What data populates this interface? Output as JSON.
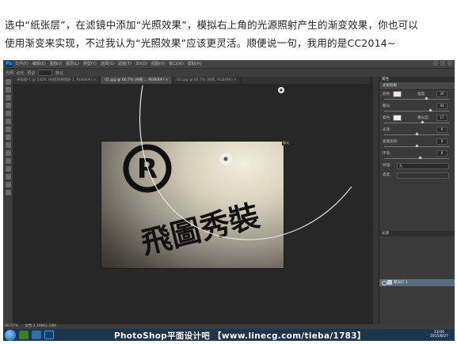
{
  "article": {
    "line1": "选中“纸张层”，在滤镜中添加“光照效果”，模拟右上角的光源照射产生的渐变效果，你也可以",
    "line2": "使用渐变来实现，不过我认为“光照效果”应该更灵活。顺便说一句，我用的是CC2014~"
  },
  "photoshop": {
    "app_logo": "Ps",
    "menu": [
      "文件(F)",
      "编辑(E)",
      "图像(I)",
      "图层(L)",
      "类型(Y)",
      "选择(S)",
      "滤镜(T)",
      "3D(D)",
      "视图(V)",
      "窗口(W)",
      "帮助(H)"
    ],
    "options": [
      "光照: 点光",
      "预设",
      "默认"
    ],
    "tabs": [
      {
        "label": "未标题-1 @ 100% (光照效果图层 1, RGB/8#) ×",
        "active": false
      },
      {
        "label": "01.jpg @ 66.7% (光照..., RGB/8#) ×",
        "active": true
      },
      {
        "label": "02.jpg @ 66.7% (背景, RGB/8#) ×",
        "active": false
      }
    ],
    "canvas": {
      "badge": "聚光",
      "logo_letter": "R",
      "text": "飛圖秀裝"
    },
    "properties": {
      "title": "属性",
      "tab": "光照效果",
      "rows": [
        {
          "label": "颜色:",
          "value": "30",
          "swatch": "#f1eadb",
          "secondary": "强度:"
        },
        {
          "label": "聚光:",
          "value": "44"
        },
        {
          "label": "着色:",
          "value": "17",
          "swatch": "#f4f1ea",
          "secondary": "曝光度:"
        },
        {
          "label": "光泽:",
          "value": "0"
        },
        {
          "label": "金属质感:",
          "value": "0"
        },
        {
          "label": "环境:",
          "value": "8"
        }
      ],
      "dropdowns": [
        {
          "label": "纹理:",
          "value": "无"
        },
        {
          "label": "高度:",
          "value": ""
        }
      ]
    },
    "layers": {
      "title": "光源",
      "item": "聚光灯 1"
    },
    "status": {
      "zoom": "66.67%",
      "doc": "文档:2.19M/2.19M"
    },
    "taskbar": {
      "watermark": "PhotoShop平面设计吧 【www.linecg.com/tieba/1783】",
      "time": "13:06",
      "date": "2015/8/27"
    }
  }
}
